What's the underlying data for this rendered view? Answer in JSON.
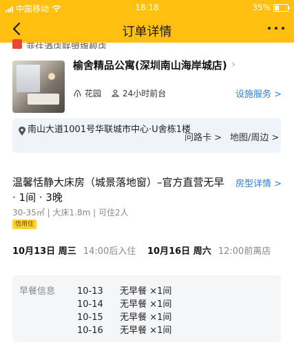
{
  "status_bar": {
    "carrier": "中国移动",
    "time": "18:18",
    "battery": "35%"
  },
  "nav": {
    "title": "订单详情"
  },
  "partial_banner": {
    "text": "菲住酒店联盟旗舰店"
  },
  "hotel": {
    "name": "榆舍精品公寓(深圳南山海岸城店)",
    "amenities": [
      "花园",
      "24小时前台"
    ],
    "facility_link": "设施服务 >"
  },
  "address": {
    "text": "南山大道1001号华联城市中心·U舍栋1楼",
    "route_card": "问路卡 >",
    "map_link": "地图/周边 >"
  },
  "room": {
    "title": "温馨恬静大床房（城景落地窗）–官方直营无早 · 1间 · 3晚",
    "detail_link": "房型详情 >",
    "spec": "30-35㎡ | 大床1.8m | 可住2人",
    "badge": "信用住"
  },
  "stay": {
    "checkin_date": "10月13日 周三",
    "checkin_time": "14:00后入住",
    "checkout_date": "10月16日 周六",
    "checkout_time": "12:00前离店"
  },
  "breakfast": {
    "label": "早餐信息",
    "rows": [
      {
        "date": "10-13",
        "value": "无早餐 ×1间"
      },
      {
        "date": "10-14",
        "value": "无早餐 ×1间"
      },
      {
        "date": "10-15",
        "value": "无早餐 ×1间"
      },
      {
        "date": "10-16",
        "value": "无早餐 ×1间"
      }
    ]
  },
  "colors": {
    "header": "#ffbf0f",
    "link": "#2b7fd6",
    "address_bg": "#eef4fa",
    "badge": "#ffd235"
  }
}
